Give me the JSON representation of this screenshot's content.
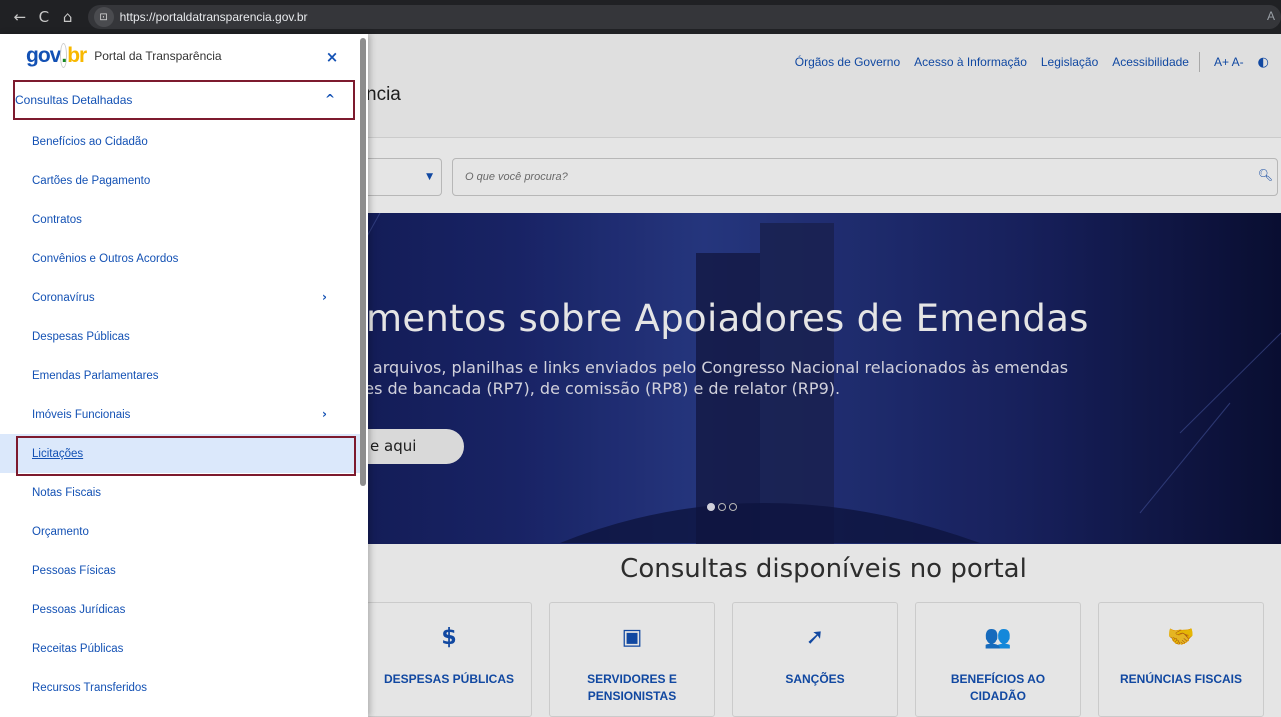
{
  "browser": {
    "back_icon": "←",
    "reload_icon": "C",
    "home_icon": "⌂",
    "lock_icon": "🔒",
    "url": "https://portaldatransparencia.gov.br",
    "corner_text": "A"
  },
  "site": {
    "top_links": [
      "Órgãos de Governo",
      "Acesso à Informação",
      "Legislação",
      "Acessibilidade"
    ],
    "font_controls": "A+ A-",
    "title_fragment": "ncia",
    "search_placeholder": "O que você procura?",
    "hero": {
      "title": "mentos sobre Apoiadores de Emendas",
      "desc_line1": "e arquivos, planilhas e links enviados pelo Congresso Nacional relacionados às emendas",
      "desc_line2": "res de bancada (RP7), de comissão (RP8) e de relator (RP9).",
      "button": "e aqui"
    },
    "section_title": "Consultas disponíveis no portal",
    "cards": [
      {
        "icon": "$",
        "label": "DESPESAS PÚBLICAS"
      },
      {
        "icon": "▣",
        "label": "SERVIDORES E PENSIONISTAS"
      },
      {
        "icon": "➚",
        "label": "SANÇÕES"
      },
      {
        "icon": "👥",
        "label": "BENEFÍCIOS AO CIDADÃO"
      },
      {
        "icon": "🤝",
        "label": "RENÚNCIAS FISCAIS"
      }
    ]
  },
  "menu": {
    "logo": {
      "g": "gov",
      "dot": ".",
      "b": "br"
    },
    "portal_name": "Portal da Transparência",
    "close_icon": "×",
    "section_label": "Consultas Detalhadas",
    "section_icon": "^",
    "items": [
      {
        "label": "Benefícios ao Cidadão"
      },
      {
        "label": "Cartões de Pagamento"
      },
      {
        "label": "Contratos"
      },
      {
        "label": "Convênios e Outros Acordos"
      },
      {
        "label": "Coronavírus",
        "chevron": "›"
      },
      {
        "label": "Despesas Públicas"
      },
      {
        "label": "Emendas Parlamentares"
      },
      {
        "label": "Imóveis Funcionais",
        "chevron": "›"
      },
      {
        "label": "Licitações"
      },
      {
        "label": "Notas Fiscais"
      },
      {
        "label": "Orçamento"
      },
      {
        "label": "Pessoas Físicas"
      },
      {
        "label": "Pessoas Jurídicas"
      },
      {
        "label": "Receitas Públicas"
      },
      {
        "label": "Recursos Transferidos"
      }
    ]
  },
  "colors": {
    "accent": "#1351b4",
    "highlight_border": "#7d1a2e",
    "active_bg": "#dbe8fb"
  }
}
